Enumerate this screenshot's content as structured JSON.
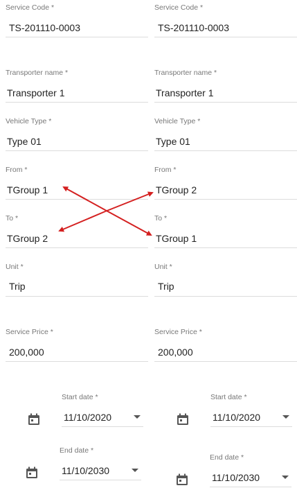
{
  "left": {
    "service_code": {
      "label": "Service Code *",
      "value": "TS-201110-0003"
    },
    "transporter_name": {
      "label": "Transporter name *",
      "value": "Transporter 1"
    },
    "vehicle_type": {
      "label": "Vehicle Type *",
      "value": "Type 01"
    },
    "from": {
      "label": "From *",
      "value": "TGroup 1"
    },
    "to": {
      "label": "To *",
      "value": "TGroup 2"
    },
    "unit": {
      "label": "Unit *",
      "value": "Trip"
    },
    "service_price": {
      "label": "Service Price *",
      "value": "200,000"
    },
    "start_date": {
      "label": "Start date *",
      "value": "11/10/2020"
    },
    "end_date": {
      "label": "End date *",
      "value": "11/10/2030"
    }
  },
  "right": {
    "service_code": {
      "label": "Service Code *",
      "value": "TS-201110-0003"
    },
    "transporter_name": {
      "label": "Transporter name *",
      "value": "Transporter 1"
    },
    "vehicle_type": {
      "label": "Vehicle Type *",
      "value": "Type 01"
    },
    "from": {
      "label": "From *",
      "value": "TGroup 2"
    },
    "to": {
      "label": "To *",
      "value": "TGroup 1"
    },
    "unit": {
      "label": "Unit *",
      "value": "Trip"
    },
    "service_price": {
      "label": "Service Price *",
      "value": "200,000"
    },
    "start_date": {
      "label": "Start date *",
      "value": "11/10/2020"
    },
    "end_date": {
      "label": "End date *",
      "value": "11/10/2030"
    }
  },
  "icons": {
    "calendar": "calendar-icon",
    "dropdown": "chevron-down-icon",
    "annotation": "crossed-red-arrows"
  },
  "colors": {
    "annotation_arrow": "#d42020",
    "label": "#777777",
    "underline": "#dcdcdc",
    "text": "#222222"
  }
}
